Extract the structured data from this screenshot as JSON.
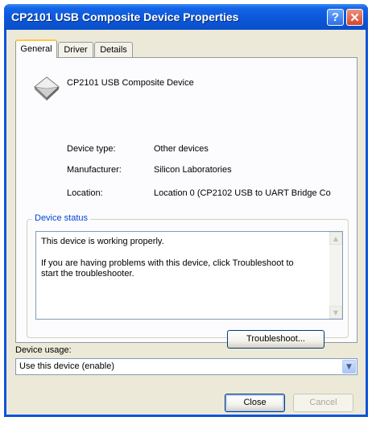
{
  "window": {
    "title": "CP2101 USB Composite Device Properties",
    "help_glyph": "?",
    "close_glyph": "✕"
  },
  "tabs": [
    {
      "label": "General",
      "active": true
    },
    {
      "label": "Driver",
      "active": false
    },
    {
      "label": "Details",
      "active": false
    }
  ],
  "device": {
    "name": "CP2101 USB Composite Device",
    "icon": "usb-device-icon",
    "props": [
      {
        "label": "Device type:",
        "value": "Other devices"
      },
      {
        "label": "Manufacturer:",
        "value": "Silicon Laboratories"
      },
      {
        "label": "Location:",
        "value": "Location 0 (CP2102 USB to UART Bridge Co"
      }
    ]
  },
  "status": {
    "legend": "Device status",
    "line1": "This device is working properly.",
    "line2": "If you are having problems with this device, click Troubleshoot to",
    "line3": "start the troubleshooter.",
    "troubleshoot_label": "Troubleshoot..."
  },
  "usage": {
    "label": "Device usage:",
    "value": "Use this device (enable)"
  },
  "footer": {
    "close_label": "Close",
    "cancel_label": "Cancel"
  },
  "colors": {
    "title_blue": "#0a55d8",
    "dialog_bg": "#ece9d8",
    "legend_blue": "#0046d5"
  }
}
